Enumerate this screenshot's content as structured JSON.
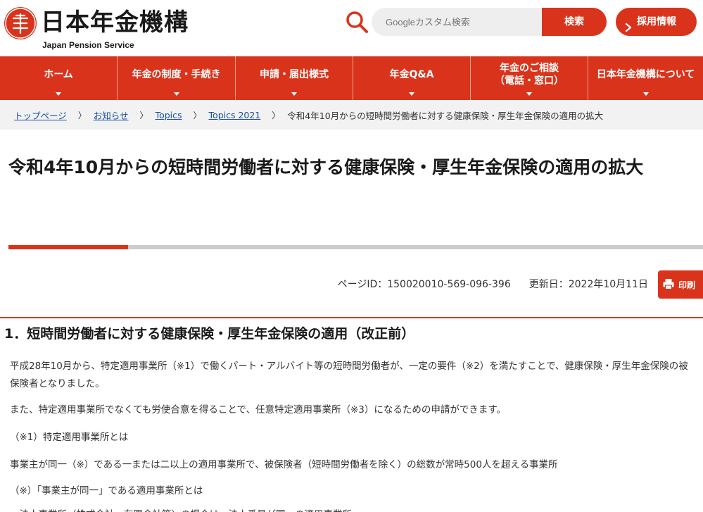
{
  "header": {
    "logo_text": "日本年金機構",
    "logo_subtext": "Japan Pension Service",
    "search": {
      "placeholder": "Googleカスタム検索",
      "button_label": "検索"
    },
    "recruit_label": "採用情報"
  },
  "nav": {
    "items": [
      {
        "label": "ホーム"
      },
      {
        "label": "年金の制度・手続き"
      },
      {
        "label": "申請・届出様式"
      },
      {
        "label": "年金Q&A"
      },
      {
        "label_line1": "年金のご相談",
        "label_line2": "（電話・窓口）"
      },
      {
        "label": "日本年金機構について"
      }
    ]
  },
  "breadcrumb": {
    "items": [
      "トップページ",
      "お知らせ",
      "Topics",
      "Topics 2021"
    ],
    "separator": "〉",
    "current": "令和4年10月からの短時間労働者に対する健康保険・厚生年金保険の適用の拡大"
  },
  "page": {
    "title": "令和4年10月からの短時間労働者に対する健康保険・厚生年金保険の適用の拡大",
    "page_id": "ページID：150020010-569-096-396",
    "updated": "更新日：2022年10月11日",
    "print_label": "印刷"
  },
  "section1": {
    "heading": "1．短時間労働者に対する健康保険・厚生年金保険の適用（改正前）",
    "p1": "平成28年10月から、特定適用事業所（※1）で働くパート・アルバイト等の短時間労働者が、一定の要件（※2）を満たすことで、健康保険・厚生年金保険の被保険者となりました。",
    "p2": "また、特定適用事業所でなくても労使合意を得ることで、任意特定適用事業所（※3）になるための申請ができます。",
    "p3": "（※1）特定適用事業所とは",
    "p4": "事業主が同一（※）である一または二以上の適用事業所で、被保険者（短時間労働者を除く）の総数が常時500人を超える事業所",
    "p5": "（※）「事業主が同一」である適用事業所とは",
    "p6": "・法人事業所（株式会社、有限会社等）の場合は、法人番号が同一の適用事業所"
  },
  "colors": {
    "brand_red": "#d9341b",
    "link_blue": "#1a4da0"
  }
}
